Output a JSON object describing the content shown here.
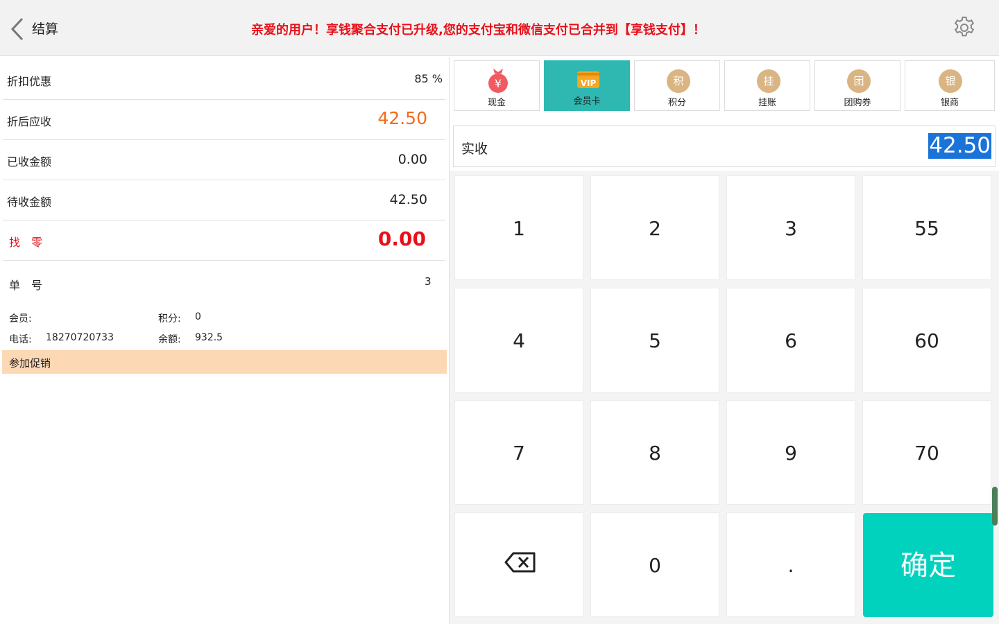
{
  "header": {
    "back_icon": "chevron-left-icon",
    "title": "结算",
    "notice": "亲爱的用户！享钱聚合支付已升级,您的支付宝和微信支付已合并到【享钱支付】！",
    "settings_icon": "gear-icon"
  },
  "summary": {
    "discount_label": "折扣优惠",
    "discount_value": "85 %",
    "receivable_label": "折后应收",
    "receivable_value": "42.50",
    "received_label": "已收金额",
    "received_value": "0.00",
    "pending_label": "待收金额",
    "pending_value": "42.50",
    "change_label": "找　零",
    "change_value": "0.00",
    "order_no_label": "单　号",
    "order_no_value": "3"
  },
  "member": {
    "member_label": "会员:",
    "member_value": "",
    "points_label": "积分:",
    "points_value": "0",
    "phone_label": "电话:",
    "phone_value": "18270720733",
    "balance_label": "余额:",
    "balance_value": "932.5"
  },
  "promo": {
    "label": "参加促销"
  },
  "pay_methods": [
    {
      "label": "现金",
      "icon": "money-bag-icon"
    },
    {
      "label": "会员卡",
      "icon": "vip-card-icon",
      "active": true
    },
    {
      "label": "积分",
      "badge": "积"
    },
    {
      "label": "挂账",
      "badge": "挂"
    },
    {
      "label": "团购券",
      "badge": "团"
    },
    {
      "label": "银商",
      "badge": "银"
    }
  ],
  "amount": {
    "label": "实收",
    "value": "42.50"
  },
  "keypad": {
    "k1": "1",
    "k2": "2",
    "k3": "3",
    "k55": "55",
    "k4": "4",
    "k5": "5",
    "k6": "6",
    "k60": "60",
    "k7": "7",
    "k8": "8",
    "k9": "9",
    "k70": "70",
    "backspace_icon": "backspace-icon",
    "k0": "0",
    "kdot": ".",
    "confirm": "确定"
  },
  "colors": {
    "notice_red": "#e8101a",
    "accent_teal": "#2eb8b1",
    "confirm_teal": "#00d2bd",
    "orange_amount": "#f26a1b",
    "promo_bg": "#fdd8b5",
    "badge_tan": "#dab583",
    "selection_blue": "#1a73d9"
  }
}
